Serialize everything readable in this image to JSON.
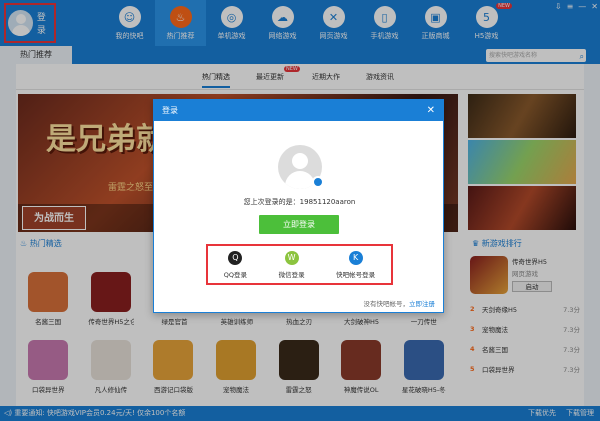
{
  "header": {
    "login_label": "登录",
    "nav": [
      {
        "label": "我的快吧",
        "icon": "avatar-icon",
        "glyph": "☺"
      },
      {
        "label": "热门推荐",
        "icon": "flame-icon",
        "glyph": "♨"
      },
      {
        "label": "单机游戏",
        "icon": "gamepad-icon",
        "glyph": "◎"
      },
      {
        "label": "网络游戏",
        "icon": "cloud-icon",
        "glyph": "☁"
      },
      {
        "label": "网页游戏",
        "icon": "swords-icon",
        "glyph": "✕"
      },
      {
        "label": "手机游戏",
        "icon": "phone-icon",
        "glyph": "▯"
      },
      {
        "label": "正版商城",
        "icon": "shop-icon",
        "glyph": "▣"
      },
      {
        "label": "H5游戏",
        "icon": "html5-icon",
        "glyph": "5",
        "badge": "NEW"
      }
    ],
    "window_controls": [
      "⇩",
      "≡",
      "—",
      "✕"
    ]
  },
  "subbar": {
    "home_tab": "热门推荐",
    "search_placeholder": "搜索快吧游戏名称"
  },
  "tabs": [
    {
      "label": "热门精选"
    },
    {
      "label": "最近更新",
      "badge": "NEW"
    },
    {
      "label": "近期大作"
    },
    {
      "label": "游戏资讯"
    }
  ],
  "banner": {
    "title": "是兄弟就来",
    "sub": "雷霆之怒至强",
    "thumb": "为战而生"
  },
  "sections": {
    "hot": "热门精选",
    "rank": "新游戏排行"
  },
  "games": [
    [
      {
        "name": "名酱三国",
        "color": "#d8703a"
      },
      {
        "name": "传奇世界H5之仑",
        "color": "#8a1f1f"
      },
      {
        "name": "绿是官首",
        "color": "#c83a2a"
      },
      {
        "name": "英雄训练师",
        "color": "#e0a040"
      },
      {
        "name": "热血之刃",
        "color": "#6a2a1a"
      },
      {
        "name": "大剑破神H5",
        "color": "#4a6a9a"
      },
      {
        "name": "一刀传世",
        "color": "#9a5a2a"
      }
    ],
    [
      {
        "name": "口袋异世界",
        "color": "#c87ab0"
      },
      {
        "name": "凡人修仙传",
        "color": "#e8e2da"
      },
      {
        "name": "西游记口袋版",
        "color": "#e8a43a"
      },
      {
        "name": "宠物魔法",
        "color": "#e0a030"
      },
      {
        "name": "雷霆之怒",
        "color": "#3a2a1a"
      },
      {
        "name": "神魔传说OL",
        "color": "#8a3a2a"
      },
      {
        "name": "星花破晓H5-冬",
        "color": "#3a6ab0"
      }
    ]
  ],
  "rank": {
    "top": {
      "name": "传奇世界H5",
      "sub": "网页游戏",
      "button": "启动"
    },
    "rows": [
      {
        "num": "2",
        "name": "天剑奇缘H5",
        "score": "7.3分"
      },
      {
        "num": "3",
        "name": "宠物魔法",
        "score": "7.3分"
      },
      {
        "num": "4",
        "name": "名酱三国",
        "score": "7.3分"
      },
      {
        "num": "5",
        "name": "口袋异世界",
        "score": "7.3分"
      }
    ]
  },
  "status": {
    "notice": "◁) 重要通知: 快吧游戏VIP会员0.24元/天! 仅余100个名额",
    "right": [
      "下载优先",
      "下载管理"
    ]
  },
  "modal": {
    "title": "登录",
    "close": "✕",
    "last_login": "您上次登录的是：19851120aaron",
    "login_button": "立即登录",
    "options": [
      {
        "label": "QQ登录",
        "icon": "qq-icon",
        "glyph": "Q"
      },
      {
        "label": "微信登录",
        "icon": "wechat-icon",
        "glyph": "W"
      },
      {
        "label": "快吧帐号登录",
        "icon": "kuaiba-icon",
        "glyph": "K"
      }
    ],
    "foot_text": "没有快吧帐号，",
    "foot_link": "立即注册"
  }
}
